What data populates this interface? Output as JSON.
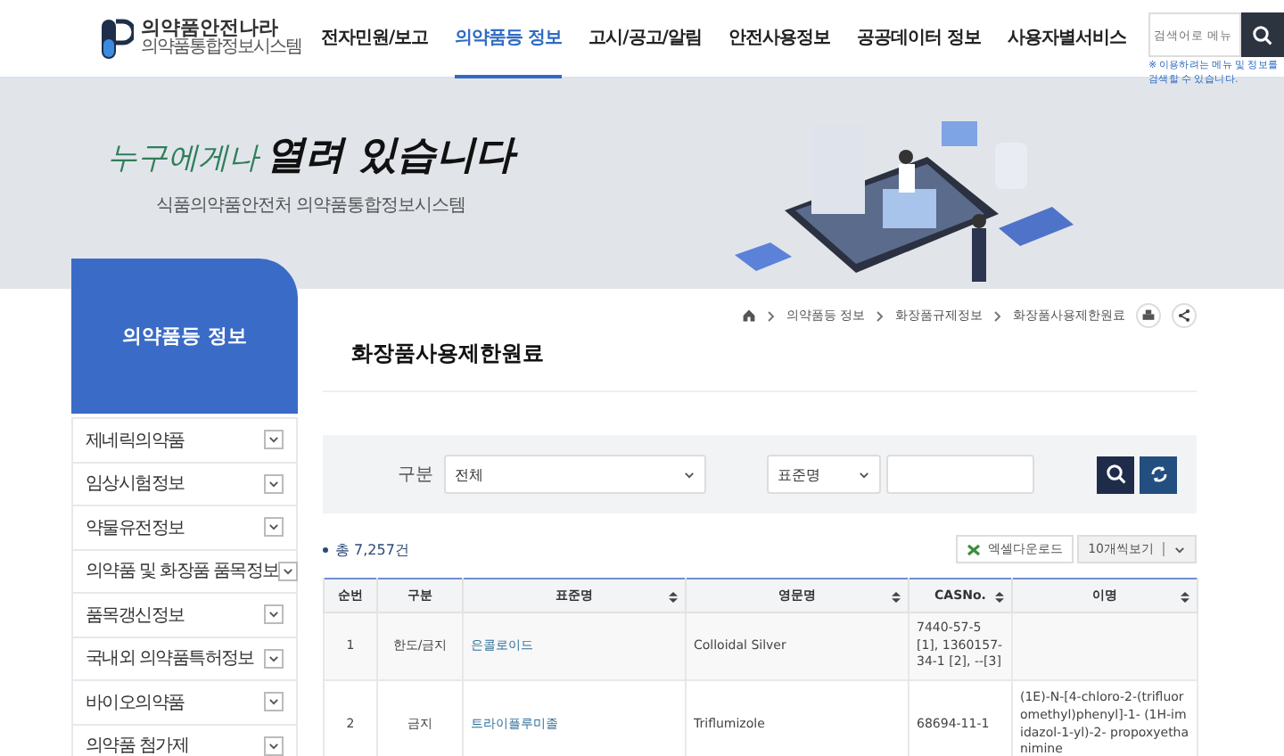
{
  "header": {
    "logo": {
      "title": "의약품안전나라",
      "subtitle": "의약품통합정보시스템"
    },
    "nav": [
      {
        "label": "전자민원/보고",
        "selected": false
      },
      {
        "label": "의약품등 정보",
        "selected": true
      },
      {
        "label": "고시/공고/알림",
        "selected": false
      },
      {
        "label": "안전사용정보",
        "selected": false
      },
      {
        "label": "공공데이터 정보",
        "selected": false
      },
      {
        "label": "사용자별서비스",
        "selected": false
      }
    ],
    "search": {
      "placeholder": "검색어로 메뉴",
      "note": "※ 이용하려는 메뉴 및 정보를 검색할 수 있습니다."
    }
  },
  "banner": {
    "slogan_lead": "누구에게나",
    "slogan_rest": "열려 있습니다",
    "subtitle": "식품의약품안전처 의약품통합정보시스템"
  },
  "sidebar": {
    "title": "의약품등 정보",
    "items": [
      {
        "label": "제네릭의약품",
        "expanded": false
      },
      {
        "label": "임상시험정보",
        "expanded": false
      },
      {
        "label": "약물유전정보",
        "expanded": false
      },
      {
        "label": "의약품 및 화장품 품목정보",
        "expanded": false
      },
      {
        "label": "품목갱신정보",
        "expanded": false
      },
      {
        "label": "국내외 의약품특허정보",
        "expanded": false
      },
      {
        "label": "바이오의약품",
        "expanded": false
      },
      {
        "label": "의약품 첨가제",
        "expanded": false
      }
    ]
  },
  "breadcrumb": [
    "의약품등 정보",
    "화장품규제정보",
    "화장품사용제한원료"
  ],
  "page_title": "화장품사용제한원료",
  "filter": {
    "category_label": "구분",
    "category_value": "전체",
    "field_value": "표준명"
  },
  "total": "총 7,257건",
  "excel_button": "엑셀다운로드",
  "page_size": "10개씩보기",
  "table": {
    "columns": [
      {
        "label": "순번",
        "sortable": false
      },
      {
        "label": "구분",
        "sortable": false
      },
      {
        "label": "표준명",
        "sortable": true
      },
      {
        "label": "영문명",
        "sortable": true
      },
      {
        "label": "CASNo.",
        "sortable": true
      },
      {
        "label": "이명",
        "sortable": true
      }
    ],
    "rows": [
      [
        "1",
        "한도/금지",
        "은콜로이드",
        "Colloidal Silver",
        "7440-57-5 [1], 1360157-34-1 [2], --[3]",
        ""
      ],
      [
        "2",
        "금지",
        "트라이플루미졸",
        "Triflumizole",
        "68694-11-1",
        "(1E)-N-[4-chloro-2-(trifluoromethyl)phenyl]-1- (1H-imidazol-1-yl)-2- propoxyethanimine"
      ]
    ]
  }
}
